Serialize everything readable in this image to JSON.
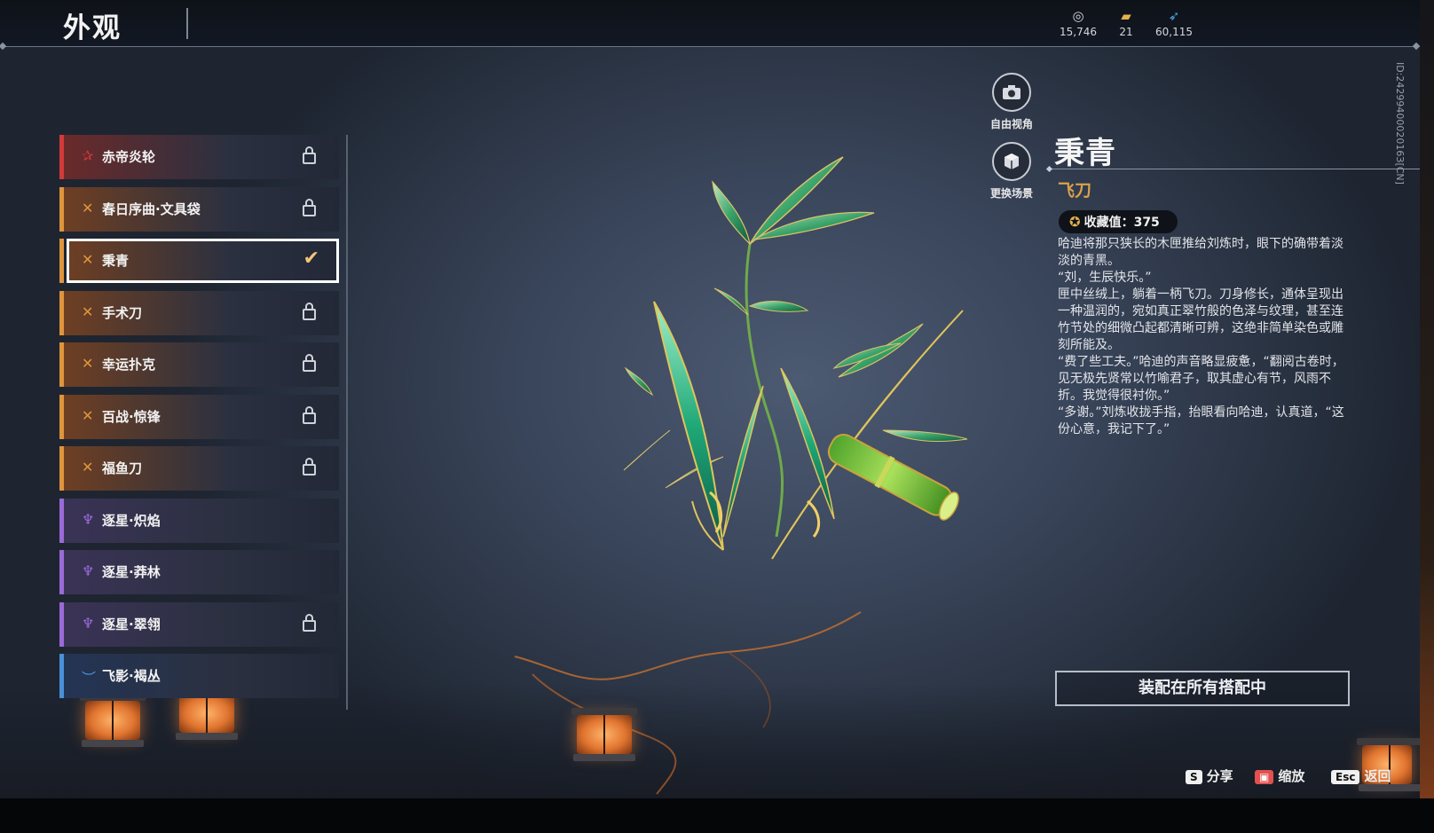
{
  "header": {
    "title": "外观"
  },
  "currencies": [
    {
      "icon": "coin-stack-icon",
      "value": "15,746"
    },
    {
      "icon": "ticket-icon",
      "value": "21"
    },
    {
      "icon": "feather-icon",
      "value": "60,115"
    }
  ],
  "tools": {
    "free_view": {
      "icon": "camera-icon",
      "label": "自由视角"
    },
    "change_scene": {
      "icon": "cube-icon",
      "label": "更换场景"
    }
  },
  "list": {
    "items": [
      {
        "label": "赤帝炎轮",
        "rarity": "red",
        "state": "locked"
      },
      {
        "label": "春日序曲·文具袋",
        "rarity": "gold",
        "state": "locked"
      },
      {
        "label": "秉青",
        "rarity": "gold",
        "state": "equipped",
        "selected": true
      },
      {
        "label": "手术刀",
        "rarity": "gold",
        "state": "locked"
      },
      {
        "label": "幸运扑克",
        "rarity": "gold",
        "state": "locked"
      },
      {
        "label": "百战·惊锋",
        "rarity": "gold",
        "state": "locked"
      },
      {
        "label": "福鱼刀",
        "rarity": "gold",
        "state": "locked"
      },
      {
        "label": "逐星·炽焰",
        "rarity": "purple",
        "state": "owned"
      },
      {
        "label": "逐星·莽林",
        "rarity": "purple",
        "state": "owned"
      },
      {
        "label": "逐星·翠翎",
        "rarity": "purple",
        "state": "locked"
      },
      {
        "label": "飞影·褐丛",
        "rarity": "blue",
        "state": "owned"
      }
    ]
  },
  "detail": {
    "name": "秉青",
    "type": "飞刀",
    "collection_label": "收藏值：375",
    "story": [
      "哈迪将那只狭长的木匣推给刘炼时，眼下的确带着淡淡的青黑。",
      "“刘，生辰快乐。”",
      "匣中丝绒上，躺着一柄飞刀。刀身修长，通体呈现出一种温润的，宛如真正翠竹般的色泽与纹理，甚至连竹节处的细微凸起都清晰可辨，这绝非简单染色或雕刻所能及。",
      "“费了些工夫。”哈迪的声音略显疲惫，“翻阅古卷时，见无极先贤常以竹喻君子，取其虚心有节，风雨不折。我觉得很衬你。”",
      "“多谢。”刘炼收拢手指，抬眼看向哈迪，认真道，“这份心意，我记下了。”"
    ],
    "equip_button": "装配在所有搭配中",
    "id_text": "ID:2429940002016З[CN]"
  },
  "hints": {
    "share": {
      "key": "S",
      "label": "分享"
    },
    "zoom": {
      "key": "mouse-icon",
      "label": "缩放"
    },
    "back": {
      "key": "Esc",
      "label": "返回"
    }
  },
  "colors": {
    "rarity_red": "#d23a3a",
    "rarity_gold": "#e0953c",
    "rarity_purple": "#9a6ad8",
    "rarity_blue": "#4a90d8",
    "accent_gold": "#d9a24d"
  }
}
